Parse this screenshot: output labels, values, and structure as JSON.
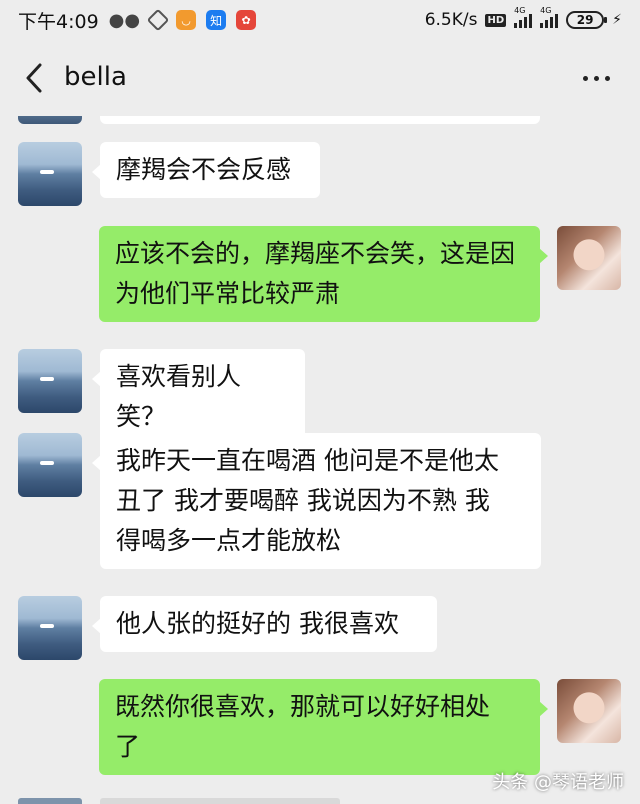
{
  "status_bar": {
    "time": "下午4:09",
    "network_speed": "6.5K/s",
    "hd_badge": "HD",
    "signal_1_label": "4G",
    "signal_2_label": "4G",
    "battery_level": "29",
    "icons": [
      "wechat-icon",
      "app-icon",
      "taobao-icon",
      "zhihu-icon",
      "news-icon"
    ]
  },
  "header": {
    "title": "bella"
  },
  "messages": [
    {
      "side": "left",
      "text": "摩羯会不会反感"
    },
    {
      "side": "right",
      "line1": "应该不会的，摩羯座不会笑，这是因",
      "line2": "为他们平常比较严肃"
    },
    {
      "side": "left",
      "text": "喜欢看别人笑？"
    },
    {
      "side": "left",
      "line1": "我昨天一直在喝酒 他问是不是他太",
      "line2": "丑了 我才要喝醉 我说因为不熟 我",
      "line3": "得喝多一点才能放松"
    },
    {
      "side": "left",
      "text": "他人张的挺好的 我很喜欢"
    },
    {
      "side": "right",
      "line1": "既然你很喜欢，那就可以好好相处",
      "line2": "了"
    }
  ],
  "watermark": "头条 @琴语老师",
  "colors": {
    "background": "#ededed",
    "bubble_self": "#95ec69",
    "bubble_other": "#ffffff"
  }
}
